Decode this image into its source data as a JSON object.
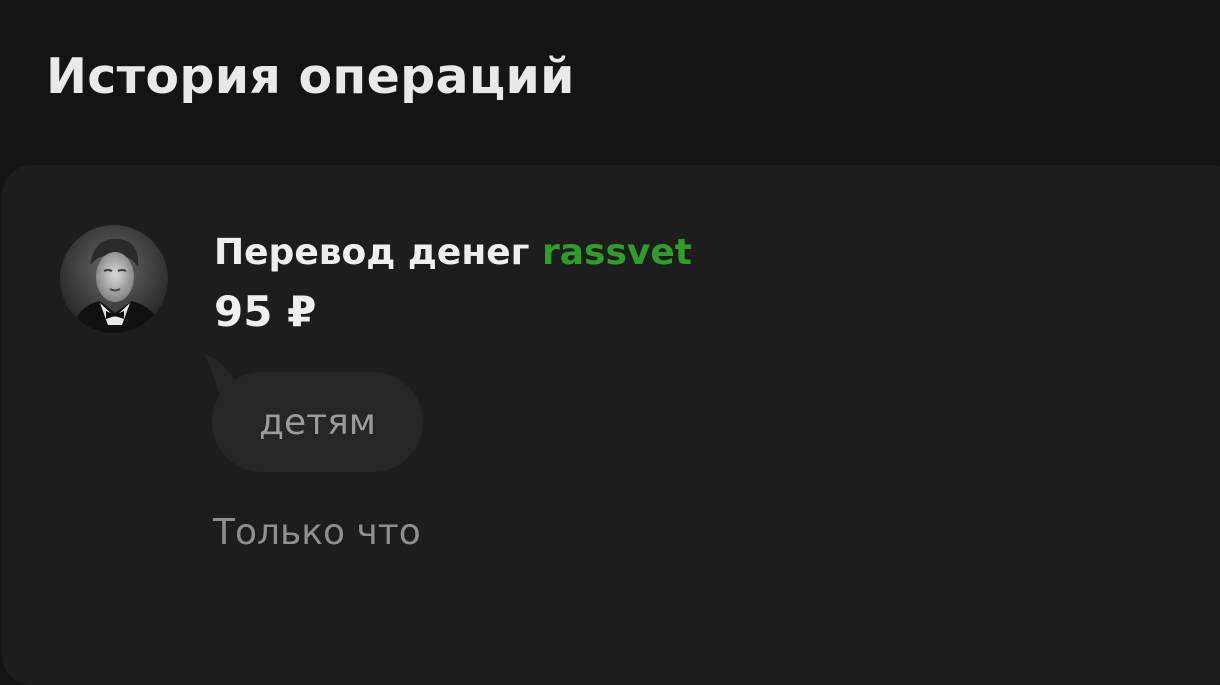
{
  "header": {
    "title": "История операций"
  },
  "transaction": {
    "title_prefix": "Перевод денег",
    "recipient": "rassvet",
    "amount": "95 ₽",
    "comment": "детям",
    "time": "Только что"
  },
  "colors": {
    "background": "#141414",
    "card": "#1d1d1d",
    "recipient_accent": "#2e9e2a",
    "bubble": "#262626"
  },
  "icons": {
    "avatar": "user-avatar-photo"
  }
}
